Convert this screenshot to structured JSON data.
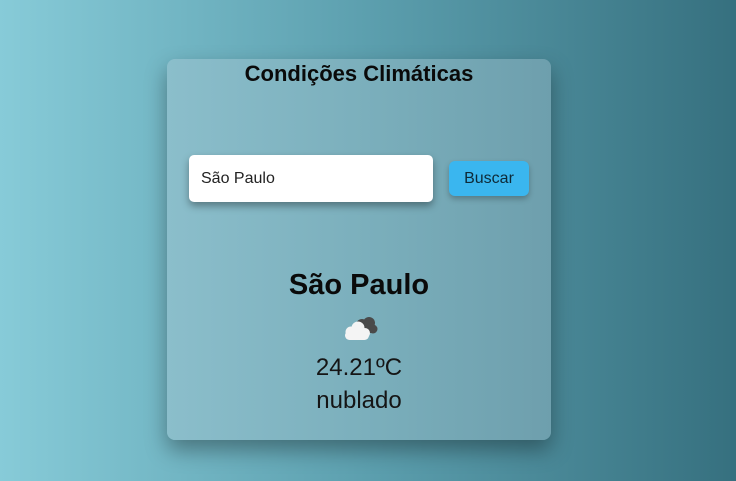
{
  "card": {
    "title": "Condições Climáticas"
  },
  "search": {
    "value": "São Paulo",
    "button_label": "Buscar"
  },
  "weather": {
    "city": "São Paulo",
    "icon": "broken-clouds-icon",
    "temperature": "24.21ºC",
    "description": "nublado"
  },
  "colors": {
    "button": "#3ab6ef",
    "background_start": "#87cbd8",
    "background_end": "#36707f"
  }
}
